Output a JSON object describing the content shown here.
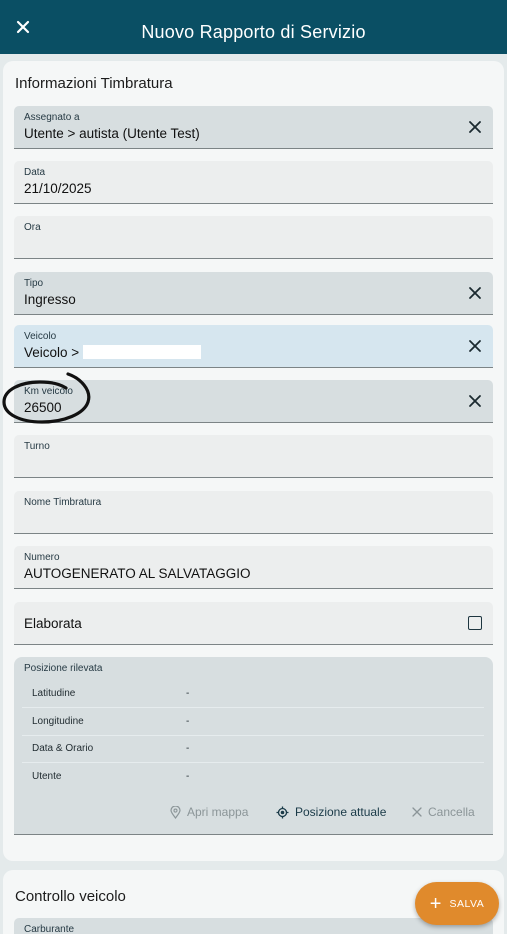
{
  "appbar": {
    "title": "Nuovo Rapporto di Servizio"
  },
  "section1": {
    "title": "Informazioni Timbratura"
  },
  "fields": {
    "assegnato": {
      "label": "Assegnato a",
      "value": "Utente > autista (Utente Test)"
    },
    "data": {
      "label": "Data",
      "value": "21/10/2025"
    },
    "ora": {
      "label": "Ora",
      "value": ""
    },
    "tipo": {
      "label": "Tipo",
      "value": "Ingresso"
    },
    "veicolo": {
      "label": "Veicolo",
      "value": "Veicolo >"
    },
    "km": {
      "label": "Km veicolo",
      "value": "26500"
    },
    "turno": {
      "label": "Turno",
      "value": ""
    },
    "nome": {
      "label": "Nome Timbratura",
      "value": ""
    },
    "numero": {
      "label": "Numero",
      "value": "AUTOGENERATO AL SALVATAGGIO"
    }
  },
  "elaborata": {
    "label": "Elaborata",
    "checked": false
  },
  "posizione": {
    "title": "Posizione rilevata",
    "rows": [
      {
        "key": "Latitudine",
        "value": "-"
      },
      {
        "key": "Longitudine",
        "value": "-"
      },
      {
        "key": "Data & Orario",
        "value": "-"
      },
      {
        "key": "Utente",
        "value": "-"
      }
    ],
    "actions": {
      "apri_mappa": "Apri mappa",
      "posizione_attuale": "Posizione attuale",
      "cancella": "Cancella"
    }
  },
  "section2": {
    "title": "Controllo veicolo"
  },
  "carburante": {
    "label": "Carburante"
  },
  "fab": {
    "label": "SALVA"
  },
  "icons": {
    "close": "close-icon",
    "clear": "clear-icon",
    "map_pin": "map-pin-icon",
    "crosshair": "crosshair-icon",
    "plus": "plus-icon"
  },
  "colors": {
    "appbar": "#0a4f64",
    "accent": "#e08a2c",
    "field": "#eceeee",
    "field_filled": "#d7dee0",
    "field_focused": "#d6e6ef"
  }
}
